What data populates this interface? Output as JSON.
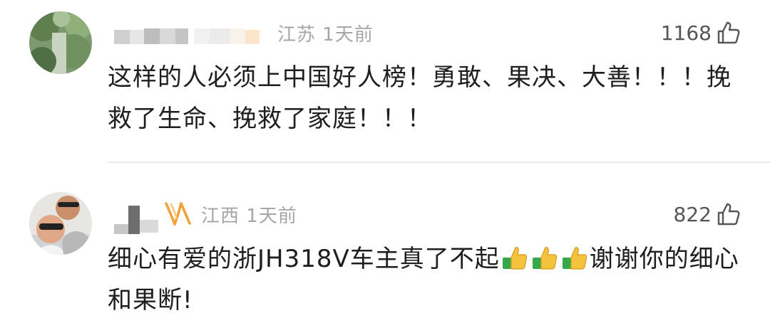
{
  "comments": [
    {
      "location": "江苏",
      "time": "1天前",
      "likes": "1168",
      "text": "这样的人必须上中国好人榜！勇敢、果决、大善！！！挽救了生命、挽救了家庭！！！"
    },
    {
      "location": "江西",
      "time": "1天前",
      "likes": "822",
      "text_before": "细心有爱的浙JH318V车主真了不起",
      "text_after": "谢谢你的细心和果断!",
      "emoji_icons": [
        "thumbs-up-emoji",
        "thumbs-up-emoji",
        "thumbs-up-emoji"
      ]
    }
  ],
  "colors": {
    "meta_text": "#a6a6a6",
    "body_text": "#1e1e1e",
    "divider": "#ebebeb",
    "vip_badge": "#f2a23a",
    "emoji_sleeve": "#35a84a",
    "emoji_hand": "#f4c23c"
  }
}
